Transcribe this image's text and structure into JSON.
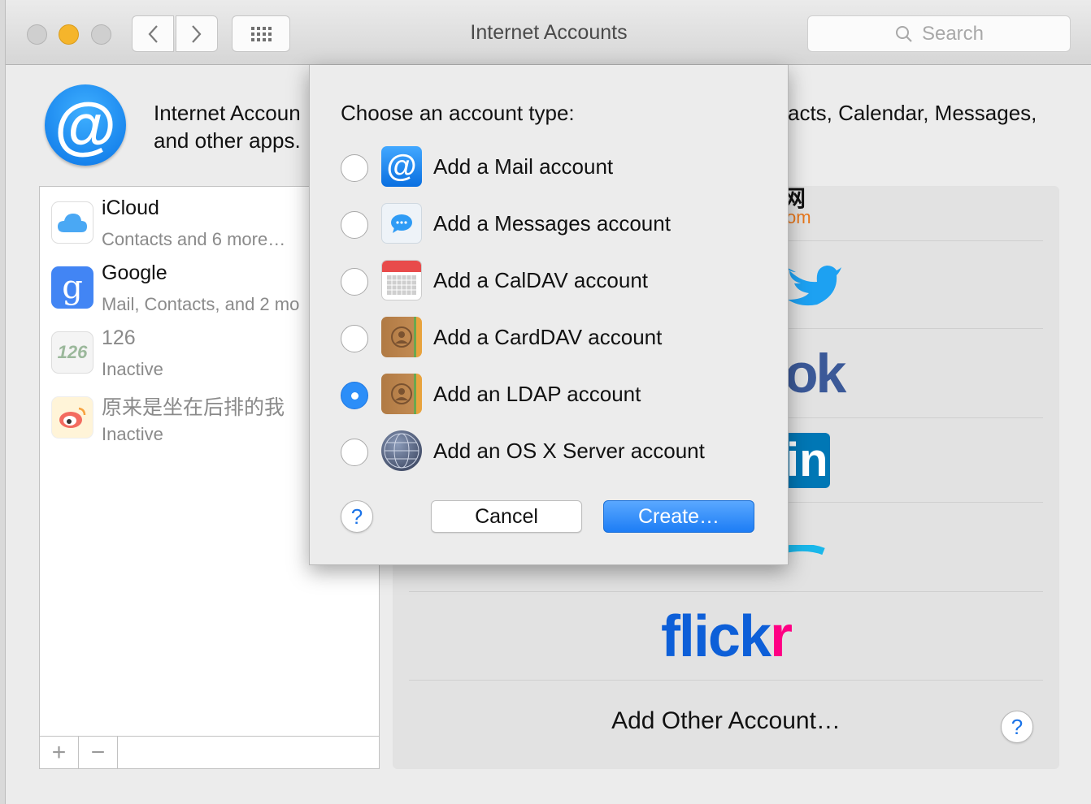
{
  "window": {
    "title": "Internet Accounts",
    "search_placeholder": "Search"
  },
  "header": {
    "description_left_line1": "Internet Accoun",
    "description_left_line2": "and other apps.",
    "description_right": "acts, Calendar, Messages,"
  },
  "accounts": [
    {
      "name": "iCloud",
      "detail": "Contacts and 6 more…",
      "icon": "icloud-icon"
    },
    {
      "name": "Google",
      "detail": "Mail, Contacts, and 2 mo",
      "icon": "google-icon"
    },
    {
      "name": "126",
      "detail": "Inactive",
      "icon": "126-icon"
    },
    {
      "name": "原来是坐在后排的我",
      "detail": "Inactive",
      "icon": "weibo-icon"
    }
  ],
  "list_bar": {
    "add_label": "+",
    "remove_label": "−"
  },
  "providers": {
    "partial_top_1": "网",
    "partial_top_2": "om",
    "facebook_partial": "ok",
    "linkedin_partial": "in",
    "flickr_blue": "flick",
    "flickr_pink": "r",
    "add_other": "Add Other Account…",
    "help": "?"
  },
  "sheet": {
    "title": "Choose an account type:",
    "options": [
      {
        "label": "Add a Mail account",
        "icon": "mail-at-icon",
        "selected": false
      },
      {
        "label": "Add a Messages account",
        "icon": "messages-icon",
        "selected": false
      },
      {
        "label": "Add a CalDAV account",
        "icon": "calendar-icon",
        "selected": false
      },
      {
        "label": "Add a CardDAV account",
        "icon": "contacts-icon",
        "selected": false
      },
      {
        "label": "Add an LDAP account",
        "icon": "contacts-icon",
        "selected": true
      },
      {
        "label": "Add an OS X Server account",
        "icon": "globe-icon",
        "selected": false
      }
    ],
    "help": "?",
    "cancel": "Cancel",
    "create": "Create…"
  },
  "colors": {
    "accent": "#2c8ef8",
    "flickr_blue": "#0d5fd8",
    "flickr_pink": "#ff0084",
    "twitter": "#1da1f2",
    "facebook": "#3b5998",
    "linkedin": "#0077b5"
  }
}
